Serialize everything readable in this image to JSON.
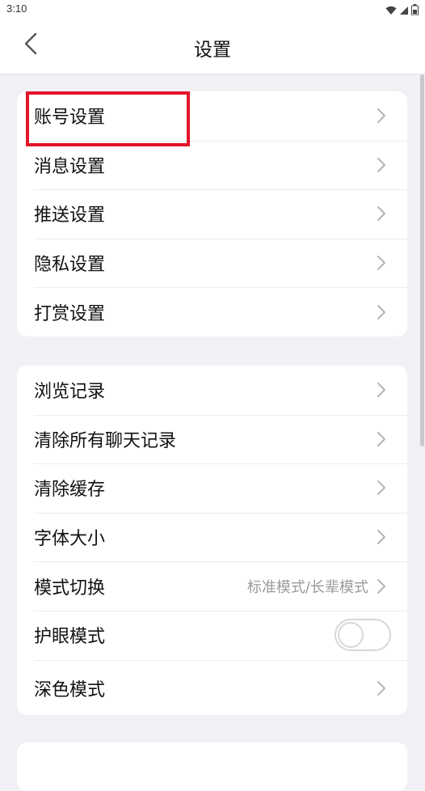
{
  "status_bar": {
    "time": "3:10",
    "icons": [
      "wifi-icon",
      "signal-icon",
      "battery-icon"
    ]
  },
  "header": {
    "title": "设置",
    "back_icon": "chevron-left-icon"
  },
  "groups": [
    {
      "items": [
        {
          "label": "账号设置",
          "type": "link"
        },
        {
          "label": "消息设置",
          "type": "link"
        },
        {
          "label": "推送设置",
          "type": "link"
        },
        {
          "label": "隐私设置",
          "type": "link"
        },
        {
          "label": "打赏设置",
          "type": "link"
        }
      ]
    },
    {
      "items": [
        {
          "label": "浏览记录",
          "type": "link"
        },
        {
          "label": "清除所有聊天记录",
          "type": "link"
        },
        {
          "label": "清除缓存",
          "type": "link"
        },
        {
          "label": "字体大小",
          "type": "link"
        },
        {
          "label": "模式切换",
          "value": "标准模式/长辈模式",
          "type": "link"
        },
        {
          "label": "护眼模式",
          "type": "toggle",
          "on": false
        },
        {
          "label": "深色模式",
          "type": "link"
        }
      ]
    }
  ],
  "colors": {
    "background": "#f1f0f5",
    "card": "#ffffff",
    "highlight": "#e3152b",
    "chevron": "#b5b5ba",
    "secondary_text": "#9a9a9f"
  }
}
